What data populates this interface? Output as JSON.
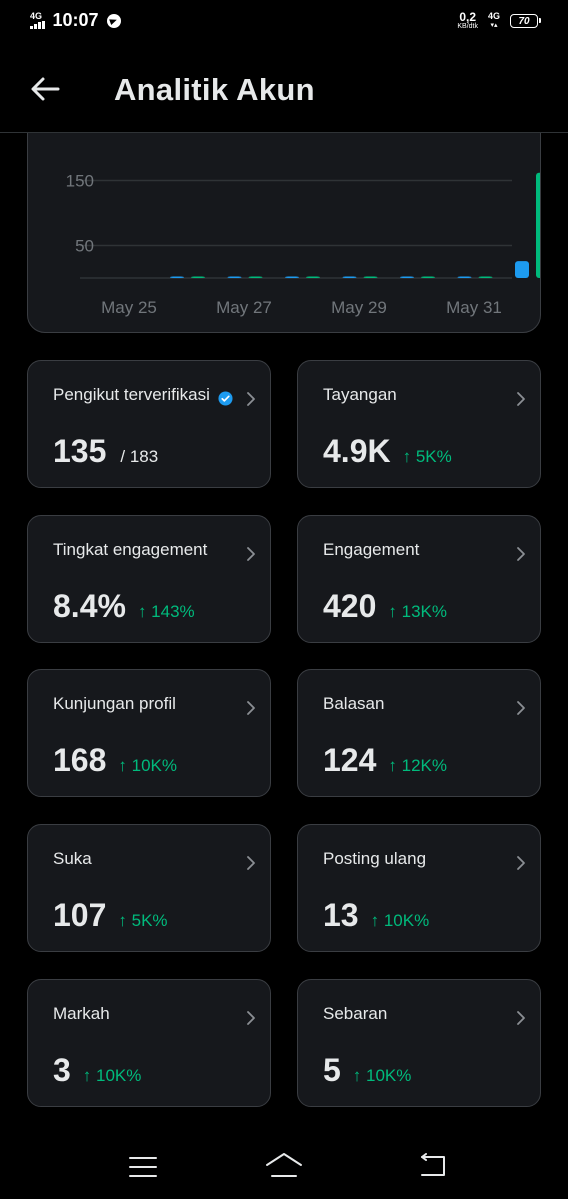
{
  "status_bar": {
    "network_left": "4G",
    "time": "10:07",
    "speed_value": "0,2",
    "speed_unit": "KB/dtk",
    "network_right": "4G",
    "battery": "70"
  },
  "header": {
    "title": "Analitik Akun",
    "back_icon": "arrow-left-icon"
  },
  "chart_data": {
    "type": "bar",
    "y_ticks": [
      "150",
      "50"
    ],
    "x_labels": [
      "May 25",
      "May 27",
      "May 29",
      "May 31"
    ],
    "ylim": [
      0,
      190
    ],
    "categories": [
      "May 24",
      "May 25",
      "May 26",
      "May 27",
      "May 28",
      "May 29",
      "May 30",
      "May 31"
    ],
    "series": [
      {
        "color": "#1d9bf0",
        "values": [
          0,
          0,
          1,
          0,
          1,
          0,
          26,
          6
        ]
      },
      {
        "color": "#00ba7c",
        "values": [
          0,
          1,
          0,
          0,
          0,
          1,
          162,
          22
        ]
      }
    ]
  },
  "metrics": [
    {
      "label": "Pengikut terverifikasi",
      "value": "135",
      "sub": "/ 183",
      "verified": true,
      "chevron_icon": "chevron-right-icon"
    },
    {
      "label": "Tayangan",
      "value": "4.9K",
      "delta": "↑ 5K%",
      "chevron_icon": "chevron-right-icon"
    },
    {
      "label": "Tingkat engagement",
      "value": "8.4%",
      "delta": "↑ 143%",
      "chevron_icon": "chevron-right-icon"
    },
    {
      "label": "Engagement",
      "value": "420",
      "delta": "↑ 13K%",
      "chevron_icon": "chevron-right-icon"
    },
    {
      "label": "Kunjungan profil",
      "value": "168",
      "delta": "↑ 10K%",
      "chevron_icon": "chevron-right-icon"
    },
    {
      "label": "Balasan",
      "value": "124",
      "delta": "↑ 12K%",
      "chevron_icon": "chevron-right-icon"
    },
    {
      "label": "Suka",
      "value": "107",
      "delta": "↑ 5K%",
      "chevron_icon": "chevron-right-icon"
    },
    {
      "label": "Posting ulang",
      "value": "13",
      "delta": "↑ 10K%",
      "chevron_icon": "chevron-right-icon"
    },
    {
      "label": "Markah",
      "value": "3",
      "delta": "↑ 10K%",
      "chevron_icon": "chevron-right-icon"
    },
    {
      "label": "Sebaran",
      "value": "5",
      "delta": "↑ 10K%",
      "chevron_icon": "chevron-right-icon"
    }
  ],
  "nav": {
    "menu_icon": "menu-icon",
    "home_icon": "home-icon",
    "back_icon": "back-icon"
  },
  "colors": {
    "background": "#000000",
    "card": "#16181c",
    "border": "#3a3d42",
    "accent_blue": "#1d9bf0",
    "accent_green": "#00ba7c"
  }
}
